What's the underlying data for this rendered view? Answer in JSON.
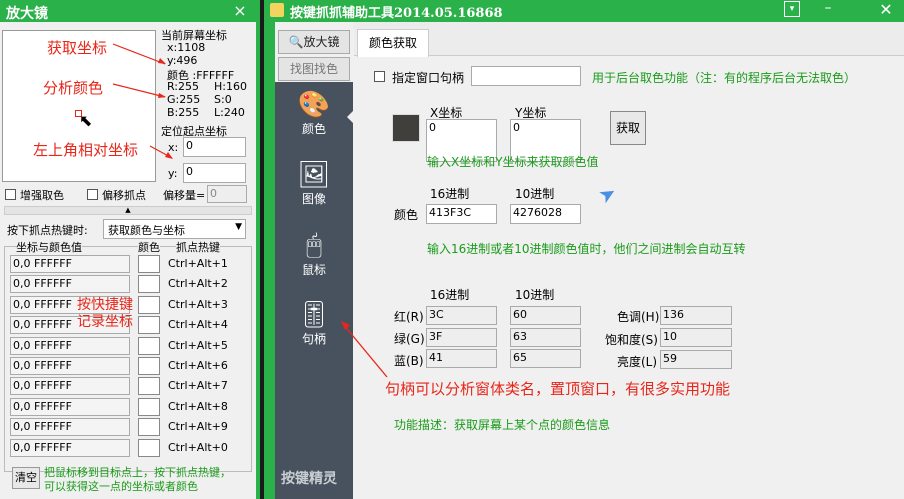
{
  "magnifier": {
    "title": "放大镜",
    "close": "×",
    "annot_coords": "获取坐标",
    "annot_color": "分析颜色",
    "annot_relative": "左上角相对坐标",
    "screen_coord_label": "当前屏幕坐标",
    "x": "x:1108",
    "y": "y:496",
    "color_label": "颜色 :FFFFFF",
    "r": "R:255",
    "h": "H:160",
    "g": "G:255",
    "s": "S:0",
    "b": "B:255",
    "l": "L:240",
    "origin_label": "定位起点坐标",
    "x_label": "x:",
    "x_val": "0",
    "y_label": "y:",
    "y_val": "0",
    "enhance_label": "增强取色",
    "offset_label": "偏移抓点",
    "offset_amount_label": "偏移量=",
    "offset_amount_val": "0",
    "hotkey_label": "按下抓点热键时:",
    "hotkey_option": "获取颜色与坐标",
    "col_coord": "坐标与颜色值",
    "col_color": "颜色",
    "col_hotkey": "抓点热键",
    "rows": [
      {
        "v": "0,0  FFFFFF",
        "k": "Ctrl+Alt+1"
      },
      {
        "v": "0,0  FFFFFF",
        "k": "Ctrl+Alt+2"
      },
      {
        "v": "0,0  FFFFFF",
        "k": "Ctrl+Alt+3"
      },
      {
        "v": "0,0  FFFFFF",
        "k": "Ctrl+Alt+4"
      },
      {
        "v": "0,0  FFFFFF",
        "k": "Ctrl+Alt+5"
      },
      {
        "v": "0,0  FFFFFF",
        "k": "Ctrl+Alt+6"
      },
      {
        "v": "0,0  FFFFFF",
        "k": "Ctrl+Alt+7"
      },
      {
        "v": "0,0  FFFFFF",
        "k": "Ctrl+Alt+8"
      },
      {
        "v": "0,0  FFFFFF",
        "k": "Ctrl+Alt+9"
      },
      {
        "v": "0,0  FFFFFF",
        "k": "Ctrl+Alt+0"
      }
    ],
    "annot_hotkey_1": "按快捷键",
    "annot_hotkey_2": "记录坐标",
    "clear": "清空",
    "hint_1": "把鼠标移到目标点上，按下抓点热键，",
    "hint_2": "可以获得这一点的坐标或者颜色"
  },
  "main": {
    "title": "按键抓抓辅助工具2014.05.16868",
    "nav_magnifier": "放大镜",
    "nav_screenshot": "找图找色",
    "nav_color": "颜色",
    "nav_image": "图像",
    "nav_mouse": "鼠标",
    "nav_handle": "句柄",
    "brand": "按键精灵",
    "tab_color_pick": "颜色获取",
    "handle_check_label": "指定窗口句柄",
    "handle_hint": "用于后台取色功能（注：有的程序后台无法取色）",
    "x_coord_label": "X坐标",
    "y_coord_label": "Y坐标",
    "x_val": "0",
    "y_val": "0",
    "get_button": "获取",
    "coord_hint": "输入X坐标和Y坐标来获取颜色值",
    "hex_label": "16进制",
    "dec_label": "10进制",
    "color_row_label": "颜色",
    "hex_val": "413F3C",
    "dec_val": "4276028",
    "convert_hint": "输入16进制或者10进制颜色值时，他们之间进制会自动互转",
    "hex_label2": "16进制",
    "dec_label2": "10进制",
    "red_label": "红(R)",
    "red_hex": "3C",
    "red_dec": "60",
    "green_label": "绿(G)",
    "green_hex": "3F",
    "green_dec": "63",
    "blue_label": "蓝(B)",
    "blue_hex": "41",
    "blue_dec": "65",
    "hue_label": "色调(H)",
    "hue_val": "136",
    "sat_label": "饱和度(S)",
    "sat_val": "10",
    "lum_label": "亮度(L)",
    "lum_val": "59",
    "annot_handle": "句柄可以分析窗体类名，置顶窗口，有很多实用功能",
    "func_desc": "功能描述：获取屏幕上某个点的颜色信息"
  },
  "colors": {
    "titlebar": "#2bb14a",
    "sidebar": "#47525e",
    "annot": "#e8261a",
    "hint": "#1a9b1a",
    "swatch": "#413f3c"
  }
}
